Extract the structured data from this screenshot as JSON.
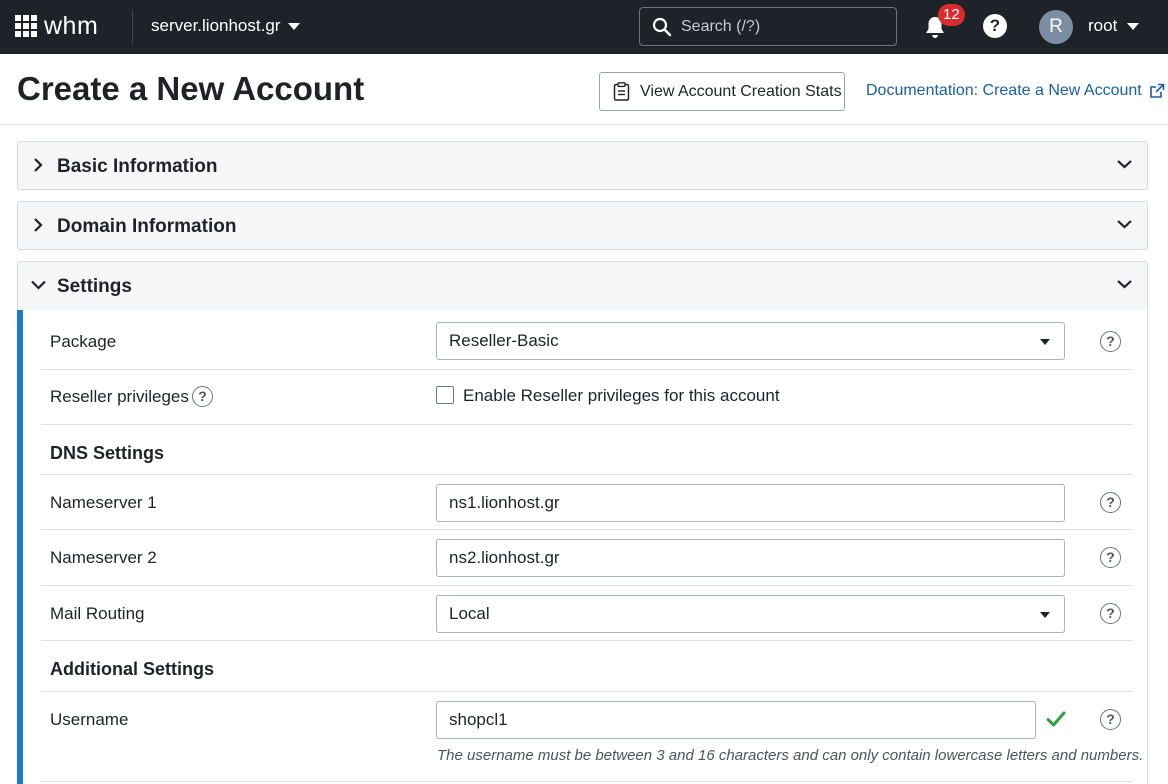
{
  "topbar": {
    "logo": "whm",
    "server": "server.lionhost.gr",
    "search_placeholder": "Search (/?)",
    "notifications_count": "12",
    "help_glyph": "?",
    "avatar_initial": "R",
    "user": "root",
    "icons": {
      "apps": "app-grid-icon",
      "search": "search-icon",
      "notifications": "bell-icon",
      "help": "help-icon"
    }
  },
  "header": {
    "title": "Create a New Account",
    "stats_button": "View Account Creation Stats",
    "doc_link": "Documentation: Create a New Account"
  },
  "panels": {
    "basic": {
      "title": "Basic Information",
      "expanded": false
    },
    "domain": {
      "title": "Domain Information",
      "expanded": false
    },
    "settings": {
      "title": "Settings",
      "expanded": true
    }
  },
  "settings": {
    "package": {
      "label": "Package",
      "value": "Reseller-Basic"
    },
    "reseller": {
      "label": "Reseller privileges",
      "checkbox_label": "Enable Reseller privileges for this account",
      "checked": false
    },
    "dns_heading": "DNS Settings",
    "ns1": {
      "label": "Nameserver 1",
      "value": "ns1.lionhost.gr"
    },
    "ns2": {
      "label": "Nameserver 2",
      "value": "ns2.lionhost.gr"
    },
    "mail": {
      "label": "Mail Routing",
      "value": "Local"
    },
    "additional_heading": "Additional Settings",
    "username": {
      "label": "Username",
      "value": "shopcl1",
      "hint": "The username must be between 3 and 16 characters and can only contain lowercase letters and numbers."
    },
    "help_glyph": "?"
  },
  "colors": {
    "topbar": "#1d2329",
    "accent": "#1f79c9",
    "link": "#1a5fa8",
    "badge": "#d92c2c",
    "valid": "#2e9e3e"
  }
}
